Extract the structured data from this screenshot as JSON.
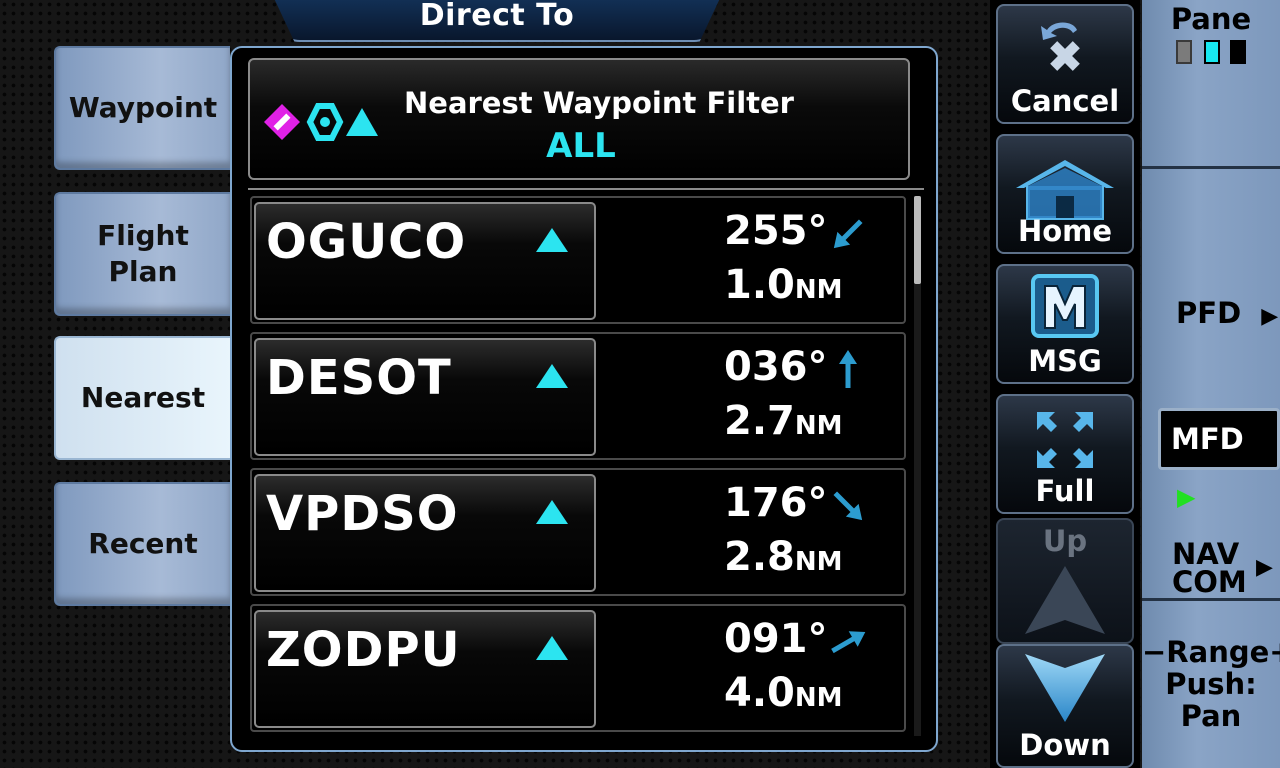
{
  "title": "Direct To",
  "tabs": [
    {
      "label": "Waypoint"
    },
    {
      "label": "Flight\nPlan"
    },
    {
      "label": "Nearest"
    },
    {
      "label": "Recent"
    }
  ],
  "filter": {
    "title": "Nearest Waypoint Filter",
    "value": "ALL",
    "icons": [
      "intersection-magenta-icon",
      "vor-cyan-icon",
      "waypoint-triangle-icon"
    ]
  },
  "waypoints": [
    {
      "name": "OGUCO",
      "bearing": "255°",
      "distance": "1.0",
      "unit": "NM",
      "arrow_deg": 225
    },
    {
      "name": "DESOT",
      "bearing": "036°",
      "distance": "2.7",
      "unit": "NM",
      "arrow_deg": 0
    },
    {
      "name": "VPDSO",
      "bearing": "176°",
      "distance": "2.8",
      "unit": "NM",
      "arrow_deg": 135
    },
    {
      "name": "ZODPU",
      "bearing": "091°",
      "distance": "4.0",
      "unit": "NM",
      "arrow_deg": 60
    }
  ],
  "buttons": {
    "cancel": "Cancel",
    "home": "Home",
    "msg": "MSG",
    "full": "Full",
    "up": "Up",
    "down": "Down"
  },
  "strip": {
    "pane": "Pane",
    "pfd": "PFD",
    "mfd": "MFD",
    "navcom_1": "NAV",
    "navcom_2": "COM",
    "range_1": "−Range+",
    "range_2": "Push:",
    "range_3": "Pan"
  },
  "colors": {
    "cyan": "#2ce4f0",
    "magenta": "#e021e6",
    "green_arrow": "#22e022"
  }
}
